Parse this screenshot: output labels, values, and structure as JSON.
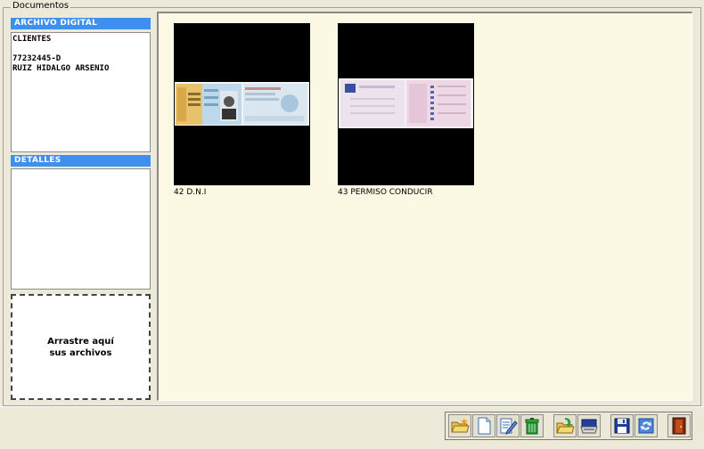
{
  "frame": {
    "title": "Documentos"
  },
  "sidebar": {
    "archivo_header": "ARCHIVO DIGITAL",
    "archivo_text": "CLIENTES\n\n77232445-D\nRUIZ HIDALGO ARSENIO",
    "detalles_header": "DETALLES",
    "detalles_text": "",
    "drop_zone": "Arrastre aquí\nsus archivos"
  },
  "documents": [
    {
      "label": "42 D.N.I",
      "kind": "id-card"
    },
    {
      "label": "43 PERMISO CONDUCIR",
      "kind": "driving-license"
    }
  ],
  "toolbar": {
    "buttons": [
      {
        "icon": "open-folder-star-icon"
      },
      {
        "icon": "new-document-icon"
      },
      {
        "icon": "edit-document-icon"
      },
      {
        "icon": "recycle-bin-icon"
      },
      {
        "icon": "import-folder-icon"
      },
      {
        "icon": "scanner-icon"
      },
      {
        "icon": "save-disk-icon"
      },
      {
        "icon": "refresh-icon"
      },
      {
        "icon": "exit-door-icon"
      }
    ]
  },
  "colors": {
    "accent": "#3f8ff0",
    "viewer_bg": "#fbf9e3",
    "window_bg": "#ece9d8"
  }
}
